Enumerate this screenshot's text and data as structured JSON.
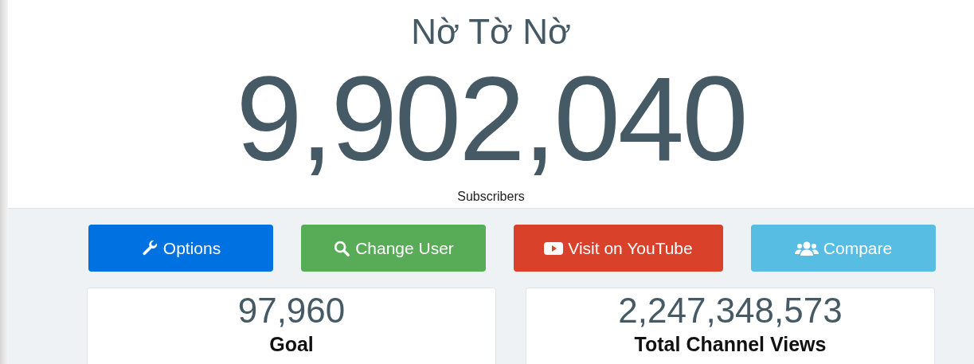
{
  "channel": {
    "name": "Nờ Tờ Nờ",
    "count": "9,902,040",
    "count_label": "Subscribers"
  },
  "buttons": [
    {
      "kind": "options",
      "label": "Options"
    },
    {
      "kind": "search",
      "label": "Change User"
    },
    {
      "kind": "youtube",
      "label": "Visit on YouTube"
    },
    {
      "kind": "compare",
      "label": "Compare"
    }
  ],
  "stats": [
    {
      "value": "97,960",
      "label": "Goal"
    },
    {
      "value": "2,247,348,573",
      "label": "Total Channel Views"
    }
  ]
}
